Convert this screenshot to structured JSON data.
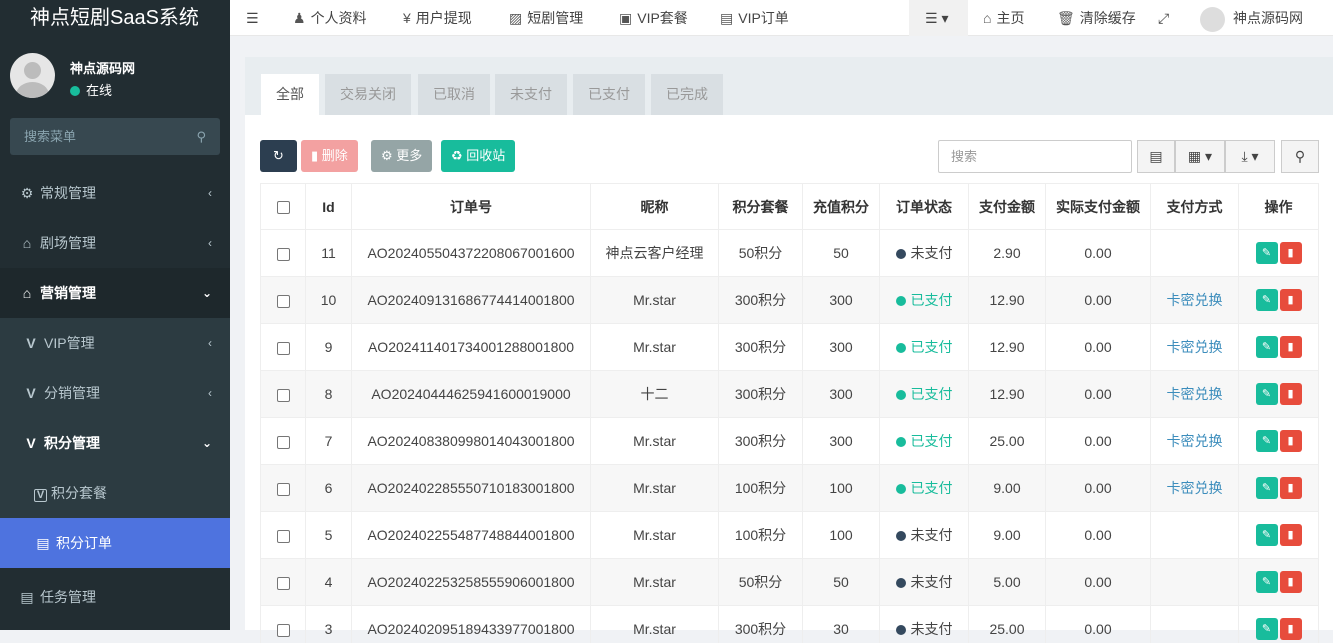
{
  "app": {
    "title": "神点短剧SaaS系统"
  },
  "user": {
    "name": "神点源码网",
    "status": "在线"
  },
  "sidebar": {
    "search_placeholder": "搜索菜单",
    "items": [
      {
        "label": "常规管理"
      },
      {
        "label": "剧场管理"
      },
      {
        "label": "营销管理"
      },
      {
        "label": "VIP管理"
      },
      {
        "label": "分销管理"
      },
      {
        "label": "积分管理"
      },
      {
        "label": "积分套餐"
      },
      {
        "label": "积分订单"
      },
      {
        "label": "任务管理"
      }
    ]
  },
  "topnav": {
    "items": [
      {
        "label": "个人资料"
      },
      {
        "label": "用户提现"
      },
      {
        "label": "短剧管理"
      },
      {
        "label": "VIP套餐"
      },
      {
        "label": "VIP订单"
      }
    ],
    "home": "主页",
    "clear_cache": "清除缓存",
    "user": "神点源码网"
  },
  "tabs": [
    "全部",
    "交易关闭",
    "已取消",
    "未支付",
    "已支付",
    "已完成"
  ],
  "toolbar": {
    "delete": "删除",
    "more": "更多",
    "recycle": "回收站",
    "search_placeholder": "搜索"
  },
  "table": {
    "headers": [
      "Id",
      "订单号",
      "昵称",
      "积分套餐",
      "充值积分",
      "订单状态",
      "支付金额",
      "实际支付金额",
      "支付方式",
      "操作"
    ],
    "rows": [
      {
        "id": "11",
        "order": "AO20240550437220806700160​0",
        "nick": "神点云客户经理",
        "pkg": "50积分",
        "points": "50",
        "status": "未支付",
        "paid": false,
        "amount": "2.90",
        "actual": "0.00",
        "method": ""
      },
      {
        "id": "10",
        "order": "AO20240913168677441400180​0",
        "nick": "Mr.star",
        "pkg": "300积分",
        "points": "300",
        "status": "已支付",
        "paid": true,
        "amount": "12.90",
        "actual": "0.00",
        "method": "卡密兑换"
      },
      {
        "id": "9",
        "order": "AO20241140173400128800180​0",
        "nick": "Mr.star",
        "pkg": "300积分",
        "points": "300",
        "status": "已支付",
        "paid": true,
        "amount": "12.90",
        "actual": "0.00",
        "method": "卡密兑换"
      },
      {
        "id": "8",
        "order": "AO20240444625941600019000",
        "nick": "十二",
        "pkg": "300积分",
        "points": "300",
        "status": "已支付",
        "paid": true,
        "amount": "12.90",
        "actual": "0.00",
        "method": "卡密兑换"
      },
      {
        "id": "7",
        "order": "AO20240838099801404300180​0",
        "nick": "Mr.star",
        "pkg": "300积分",
        "points": "300",
        "status": "已支付",
        "paid": true,
        "amount": "25.00",
        "actual": "0.00",
        "method": "卡密兑换"
      },
      {
        "id": "6",
        "order": "AO20240228555071018300180​0",
        "nick": "Mr.star",
        "pkg": "100积分",
        "points": "100",
        "status": "已支付",
        "paid": true,
        "amount": "9.00",
        "actual": "0.00",
        "method": "卡密兑换"
      },
      {
        "id": "5",
        "order": "AO20240225548774884400180​0",
        "nick": "Mr.star",
        "pkg": "100积分",
        "points": "100",
        "status": "未支付",
        "paid": false,
        "amount": "9.00",
        "actual": "0.00",
        "method": ""
      },
      {
        "id": "4",
        "order": "AO20240225325855590600180​0",
        "nick": "Mr.star",
        "pkg": "50积分",
        "points": "50",
        "status": "未支付",
        "paid": false,
        "amount": "5.00",
        "actual": "0.00",
        "method": ""
      },
      {
        "id": "3",
        "order": "AO20240209518943397700180​0",
        "nick": "Mr.star",
        "pkg": "300积分",
        "points": "30",
        "status": "未支付",
        "paid": false,
        "amount": "25.00",
        "actual": "0.00",
        "method": ""
      }
    ]
  },
  "colors": {
    "sidebar": "#222d32",
    "active": "#4e73df",
    "success": "#18bc9c",
    "danger": "#e74c3c",
    "primary_dark": "#2c3e50"
  }
}
